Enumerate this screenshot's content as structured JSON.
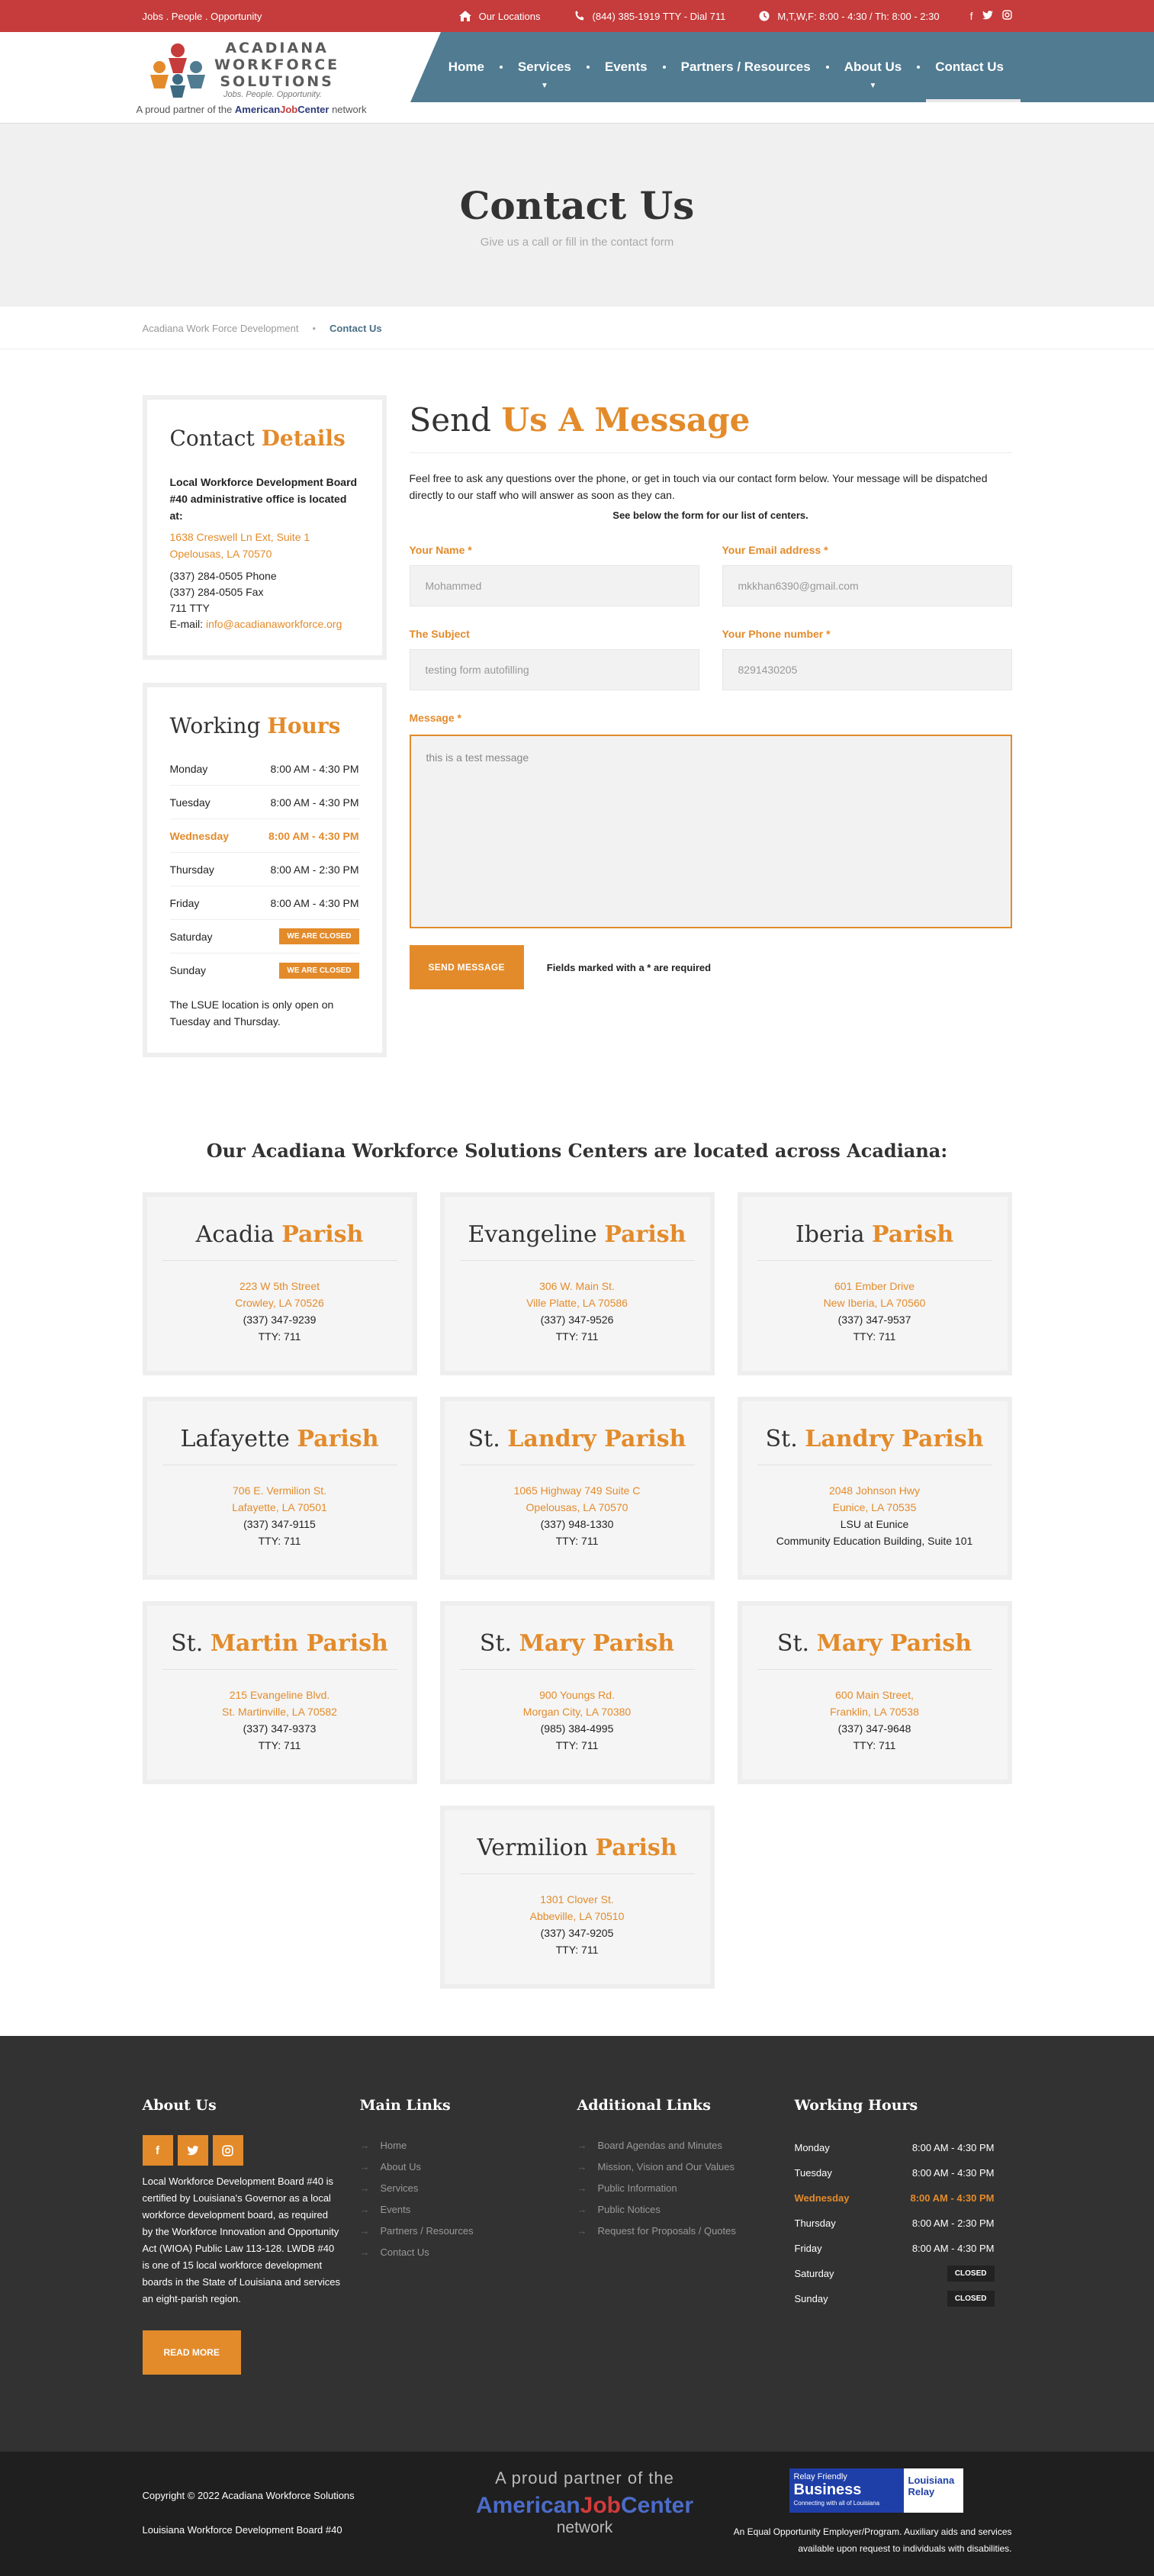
{
  "topbar": {
    "tagline": "Jobs . People . Opportunity",
    "locations": "Our Locations",
    "phone": "(844) 385-1919 TTY - Dial 711",
    "hours": "M,T,W,F: 8:00 - 4:30 / Th: 8:00 - 2:30",
    "social": [
      "f",
      "t",
      "i"
    ]
  },
  "logo": {
    "line1": "ACADIANA",
    "line2": "WORKFORCE",
    "line3": "SOLUTIONS",
    "sub": "Jobs. People. Opportunity."
  },
  "nav": [
    {
      "label": "Home"
    },
    {
      "label": "Services"
    },
    {
      "label": "Events"
    },
    {
      "label": "Partners / Resources"
    },
    {
      "label": "About Us"
    },
    {
      "label": "Contact Us"
    }
  ],
  "partner": {
    "pre": "A proud partner of the",
    "american": "American",
    "job": "Job",
    "center": "Center",
    "post": "network"
  },
  "hero": {
    "title": "Contact Us",
    "subtitle": "Give us a call or fill in the contact form"
  },
  "breadcrumb": {
    "home": "Acadiana Work Force Development",
    "current": "Contact Us"
  },
  "contact": {
    "title_a": "Contact",
    "title_b": "Details",
    "intro": "Local Workforce Development Board #40 administrative office is located at:",
    "addr1": "1638 Creswell Ln Ext, Suite 1",
    "addr2": "Opelousas, LA 70570",
    "phone": "(337) 284-0505 Phone",
    "fax": "(337) 284-0505 Fax",
    "tty": "711 TTY",
    "email_label": "E-mail:",
    "email": "info@acadianaworkforce.org"
  },
  "hours": {
    "title_a": "Working",
    "title_b": "Hours",
    "rows": [
      {
        "day": "Monday",
        "time": "8:00 AM - 4:30 PM"
      },
      {
        "day": "Tuesday",
        "time": "8:00 AM - 4:30 PM"
      },
      {
        "day": "Wednesday",
        "time": "8:00 AM - 4:30 PM"
      },
      {
        "day": "Thursday",
        "time": "8:00 AM - 2:30 PM"
      },
      {
        "day": "Friday",
        "time": "8:00 AM - 4:30 PM"
      },
      {
        "day": "Saturday",
        "time": "WE ARE CLOSED"
      },
      {
        "day": "Sunday",
        "time": "WE ARE CLOSED"
      }
    ],
    "note": "The LSUE location is only open on Tuesday and Thursday."
  },
  "form": {
    "title_a": "Send",
    "title_b": "Us A Message",
    "intro": "Feel free to ask any  questions over the phone, or get in touch via our contact form below. Your message will be dispatched directly to our staff who will answer as soon as they can.",
    "see": "See below the form for our list of centers.",
    "name_label": "Your Name *",
    "name_value": "Mohammed",
    "email_label": "Your Email address *",
    "email_value": "mkkhan6390@gmail.com",
    "subject_label": "The Subject",
    "subject_value": "testing form autofilling",
    "phone_label": "Your Phone number *",
    "phone_value": "8291430205",
    "message_label": "Message *",
    "message_value": "this is a test message",
    "send": "SEND MESSAGE",
    "required": "Fields marked with a * are required"
  },
  "locations": {
    "heading": "Our Acadiana Workforce Solutions Centers are located across Acadiana:",
    "items": [
      {
        "a": "Acadia",
        "b": "Parish",
        "l1": "223 W 5th Street",
        "l2": "Crowley, LA 70526",
        "p1": "(337) 347-9239",
        "p2": "TTY: 711"
      },
      {
        "a": "Evangeline",
        "b": "Parish",
        "l1": "306 W. Main St.",
        "l2": "Ville Platte, LA 70586",
        "p1": "(337) 347-9526",
        "p2": "TTY: 711"
      },
      {
        "a": "Iberia",
        "b": "Parish",
        "l1": "601 Ember Drive",
        "l2": "New Iberia, LA 70560",
        "p1": "(337) 347-9537",
        "p2": "TTY: 711"
      },
      {
        "a": "Lafayette",
        "b": "Parish",
        "l1": "706 E. Vermilion St.",
        "l2": "Lafayette, LA 70501",
        "p1": "(337) 347-9115",
        "p2": "TTY: 711"
      },
      {
        "a": "St.",
        "b": "Landry Parish",
        "l1": "1065 Highway 749 Suite C",
        "l2": "Opelousas, LA 70570",
        "p1": "(337) 948-1330",
        "p2": "TTY: 711"
      },
      {
        "a": "St.",
        "b": "Landry Parish",
        "l1": "2048 Johnson Hwy",
        "l2": "Eunice, LA 70535",
        "p1": "LSU at Eunice",
        "p2": "Community Education Building, Suite 101"
      },
      {
        "a": "St.",
        "b": "Martin Parish",
        "l1": "215 Evangeline Blvd.",
        "l2": "St. Martinville, LA 70582",
        "p1": "(337) 347-9373",
        "p2": "TTY: 711"
      },
      {
        "a": "St.",
        "b": "Mary Parish",
        "l1": "900 Youngs Rd.",
        "l2": "Morgan City, LA 70380",
        "p1": "(985) 384-4995",
        "p2": "TTY: 711"
      },
      {
        "a": "St.",
        "b": "Mary Parish",
        "l1": "600 Main Street,",
        "l2": "Franklin, LA 70538",
        "p1": "(337) 347-9648",
        "p2": "TTY: 711"
      },
      {
        "a": "Vermilion",
        "b": "Parish",
        "l1": "1301 Clover St.",
        "l2": "Abbeville, LA 70510",
        "p1": "(337) 347-9205",
        "p2": "TTY: 711"
      }
    ]
  },
  "footer": {
    "about_title": "About Us",
    "about_text": "Local Workforce Development Board #40 is certified by Louisiana's Governor as a local workforce development board, as required by the Workforce Innovation and Opportunity Act (WIOA) Public Law 113-128. LWDB #40 is one of 15 local workforce development boards in the State of Louisiana and services an eight-parish region.",
    "read_more": "READ MORE",
    "main_title": "Main Links",
    "main_links": [
      "Home",
      "About Us",
      "Services",
      "Events",
      "Partners / Resources",
      "Contact Us"
    ],
    "add_title": "Additional Links",
    "add_links": [
      "Board Agendas and Minutes",
      "Mission, Vision and Our Values",
      "Public Information",
      "Public Notices",
      "Request for Proposals / Quotes"
    ],
    "hours_title": "Working Hours",
    "hours": [
      {
        "day": "Monday",
        "time": "8:00 AM - 4:30 PM"
      },
      {
        "day": "Tuesday",
        "time": "8:00 AM - 4:30 PM"
      },
      {
        "day": "Wednesday",
        "time": "8:00 AM - 4:30 PM"
      },
      {
        "day": "Thursday",
        "time": "8:00 AM - 2:30 PM"
      },
      {
        "day": "Friday",
        "time": "8:00 AM - 4:30 PM"
      },
      {
        "day": "Saturday",
        "time": "CLOSED"
      },
      {
        "day": "Sunday",
        "time": "CLOSED"
      }
    ]
  },
  "bottom": {
    "copyright": "Copyright © 2022 Acadiana Workforce Solutions",
    "board": "Louisiana Workforce Development Board #40",
    "ajc_pre": "A proud partner of the",
    "ajc_american": "American",
    "ajc_job": "Job",
    "ajc_center": "Center",
    "ajc_post": "network",
    "relay_top": "Relay Friendly",
    "relay_business": "Business",
    "relay_sub": "Connecting with all of Louisiana",
    "relay_right1": "Louisiana",
    "relay_right2": "Relay",
    "eo": "An Equal Opportunity Employer/Program. Auxiliary aids and services available upon request to individuals with disabilities."
  },
  "colors": {
    "topbar": "#c63b3b",
    "nav": "#507b91",
    "accent": "#e38b2b",
    "footer": "#323232"
  }
}
